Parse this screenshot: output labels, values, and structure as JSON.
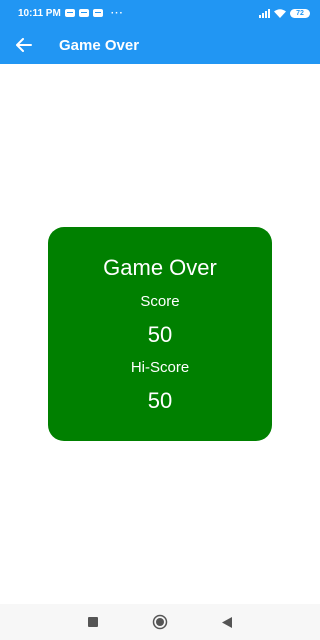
{
  "status_bar": {
    "time": "10:11 PM",
    "more": "···",
    "battery": "72"
  },
  "app_bar": {
    "title": "Game Over",
    "back_icon": "arrow-left-icon"
  },
  "card": {
    "title": "Game Over",
    "score_label": "Score",
    "score_value": "50",
    "hiscore_label": "Hi-Score",
    "hiscore_value": "50",
    "color": "#008000"
  },
  "nav": {
    "recents_icon": "square-icon",
    "home_icon": "circle-icon",
    "back_icon": "triangle-back-icon"
  },
  "colors": {
    "primary": "#2196f3",
    "card": "#008000"
  }
}
